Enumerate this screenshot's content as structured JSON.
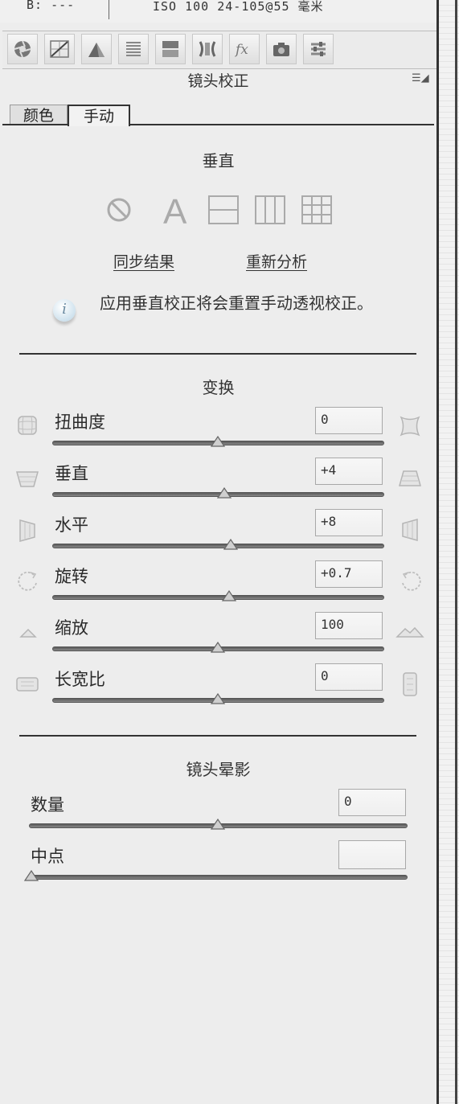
{
  "top_info": {
    "rgb_readout": "B: ---",
    "camera_meta": "ISO 100  24-105@55 毫米"
  },
  "toolbar": {
    "icons": [
      "aperture-icon",
      "tone-curve-icon",
      "detail-icon",
      "hsl-icon",
      "split-toning-icon",
      "lens-correction-icon",
      "fx-icon",
      "camera-calibration-icon",
      "presets-icon"
    ]
  },
  "panel": {
    "title": "镜头校正"
  },
  "tabs": [
    {
      "label": "颜色"
    },
    {
      "label": "手动"
    }
  ],
  "upright": {
    "title": "垂直",
    "modes": [
      "off-icon",
      "auto-icon",
      "level-icon",
      "vertical-icon",
      "full-icon"
    ],
    "sync_label": "同步结果",
    "reanalyze_label": "重新分析",
    "info_text": "应用垂直校正将会重置手动透视校正。"
  },
  "transform": {
    "title": "变换",
    "sliders": [
      {
        "label": "扭曲度",
        "value": "0"
      },
      {
        "label": "垂直",
        "value": "+4"
      },
      {
        "label": "水平",
        "value": "+8"
      },
      {
        "label": "旋转",
        "value": "+0.7"
      },
      {
        "label": "缩放",
        "value": "100"
      },
      {
        "label": "长宽比",
        "value": "0"
      }
    ]
  },
  "vignetting": {
    "title": "镜头晕影",
    "sliders": [
      {
        "label": "数量",
        "value": "0"
      },
      {
        "label": "中点",
        "value": ""
      }
    ]
  }
}
